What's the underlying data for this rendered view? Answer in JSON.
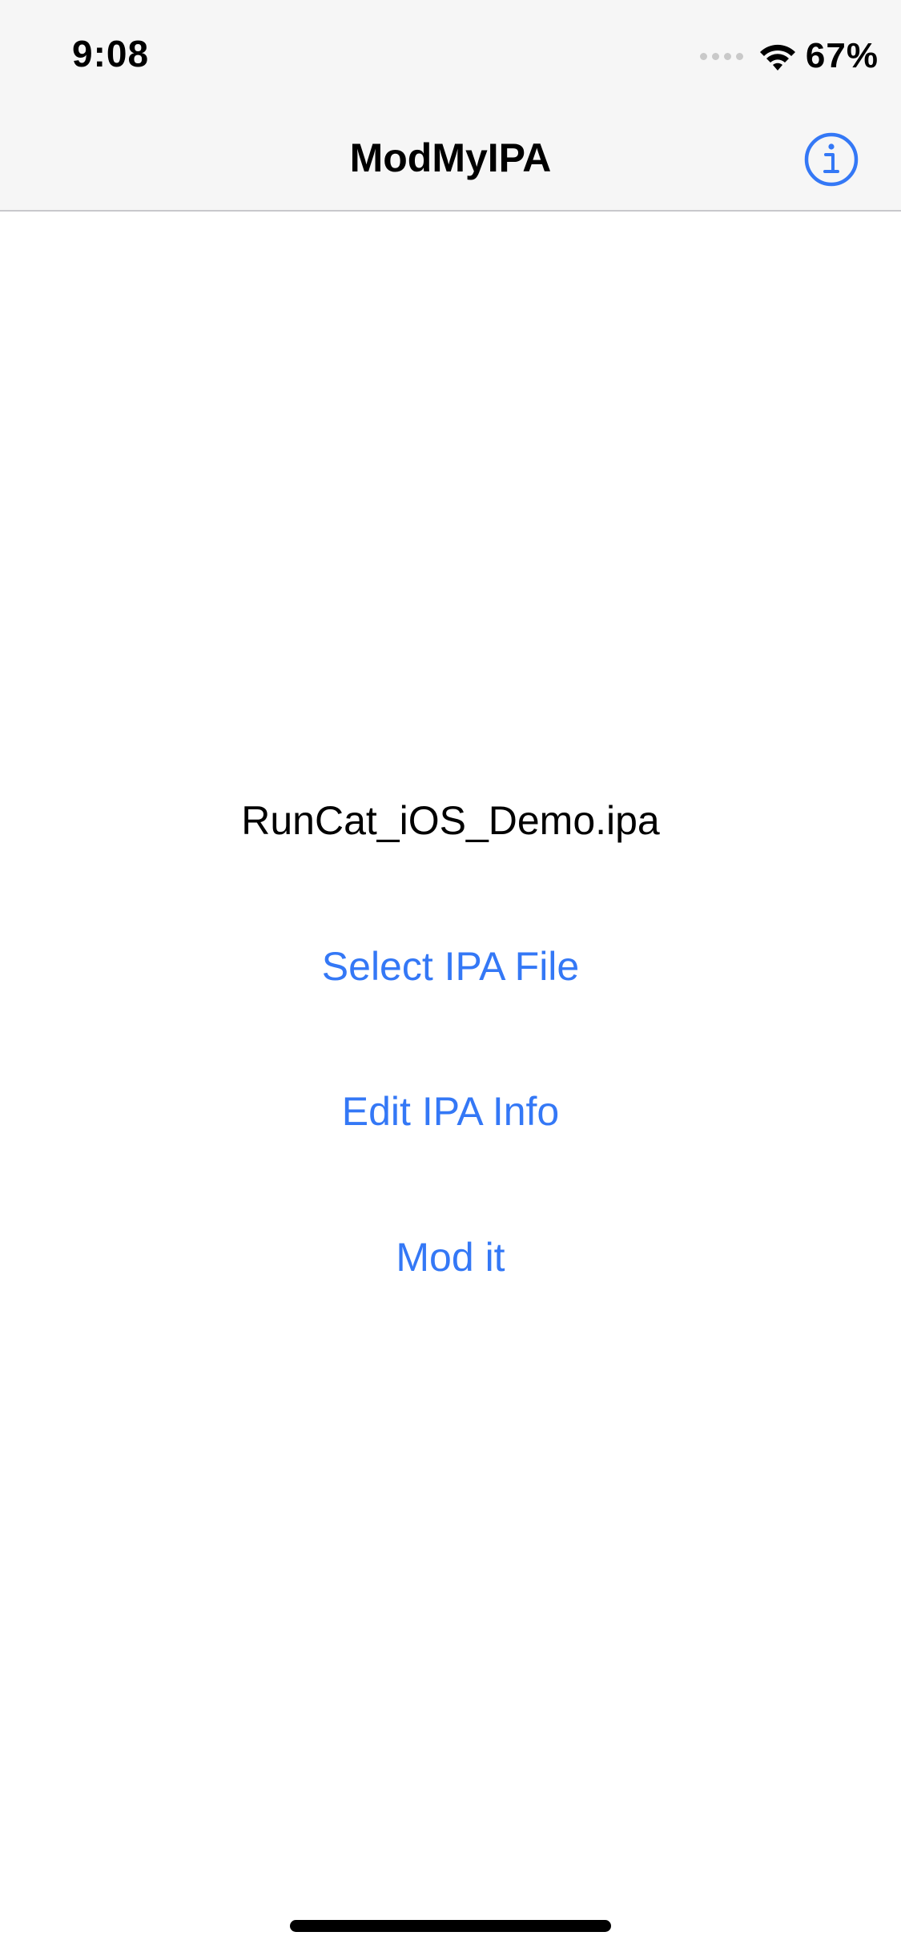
{
  "status_bar": {
    "time": "9:08",
    "battery": "67%",
    "icons": [
      "signal-dots-icon",
      "wifi-icon"
    ]
  },
  "nav": {
    "title": "ModMyIPA",
    "info_icon": "info-circle-icon",
    "accent": "#3478f6"
  },
  "main": {
    "file_name": "RunCat_iOS_Demo.ipa",
    "select_label": "Select IPA File",
    "edit_label": "Edit IPA Info",
    "mod_label": "Mod it"
  }
}
